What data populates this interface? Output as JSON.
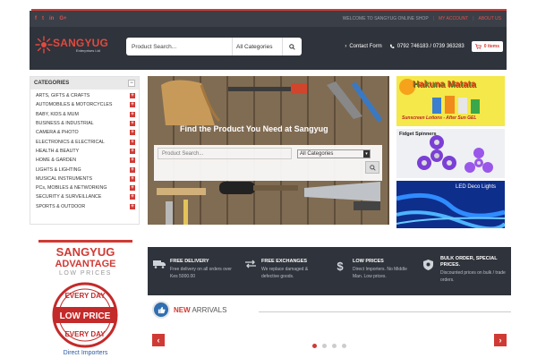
{
  "topbar": {
    "social": [
      "f",
      "t",
      "in",
      "G+"
    ],
    "welcome": "WELCOME TO SANGYUG ONLINE SHOP",
    "my_account": "MY ACCOUNT",
    "about_us": "ABOUT US"
  },
  "header": {
    "brand": "SANGYUG",
    "brand_sub": "Enterprises Ltd",
    "search_placeholder": "Product Search...",
    "search_category": "All Categories",
    "contact": "Contact Form",
    "phones": "0792 746183 / 0739 363283",
    "cart": "0 items"
  },
  "sidebar": {
    "title": "CATEGORIES",
    "items": [
      "ARTS, GIFTS & CRAFTS",
      "AUTOMOBILES & MOTORCYCLES",
      "BABY, KIDS & MUM",
      "BUSINESS & INDUSTRIAL",
      "CAMERA & PHOTO",
      "ELECTRONICS & ELECTRICAL",
      "HEALTH & BEAUTY",
      "HOME & GARDEN",
      "LIGHTS & LIGHTING",
      "MUSICAL INSTRUMENTS",
      "PCs, MOBILES & NETWORKING",
      "SECURITY & SURVEILLANCE",
      "SPORTS & OUTDOOR"
    ]
  },
  "hero": {
    "title": "Find the Product You Need at Sangyug",
    "search_placeholder": "Product Search...",
    "category": "All Categories"
  },
  "banners": {
    "b1_title": "Hakuna Matata",
    "b1_sub": "Sunscreen Lotions - After Sun GEL",
    "b2_title": "Fidget Spinners",
    "b3_title": "LED Deco Lights"
  },
  "advantage": {
    "line1": "SANGYUG",
    "line2": "ADVANTAGE",
    "line3": "LOW PRICES",
    "seal_top": "EVERY DAY",
    "seal_mid": "LOW PRICE",
    "seal_bottom": "EVERY DAY",
    "footer": "Direct Importers"
  },
  "features": [
    {
      "title": "FREE DELIVERY",
      "desc": "Free delivery on all orders over Kes 5000.00",
      "icon": "truck-icon"
    },
    {
      "title": "FREE EXCHANGES",
      "desc": "We replace damaged & defective goods.",
      "icon": "exchange-icon"
    },
    {
      "title": "LOW PRICES",
      "desc": "Direct Importers. No Middle Man. Low prices.",
      "icon": "dollar-icon"
    },
    {
      "title": "BULK ORDER, SPECIAL PRICES.",
      "desc": "Discounted prices on bulk / trade orders.",
      "icon": "badge-icon"
    }
  ],
  "arrivals": {
    "new": "NEW",
    "label": "ARRIVALS",
    "prev": "‹",
    "next": "›"
  },
  "colors": {
    "accent": "#d03a35",
    "dark": "#2f333b"
  }
}
